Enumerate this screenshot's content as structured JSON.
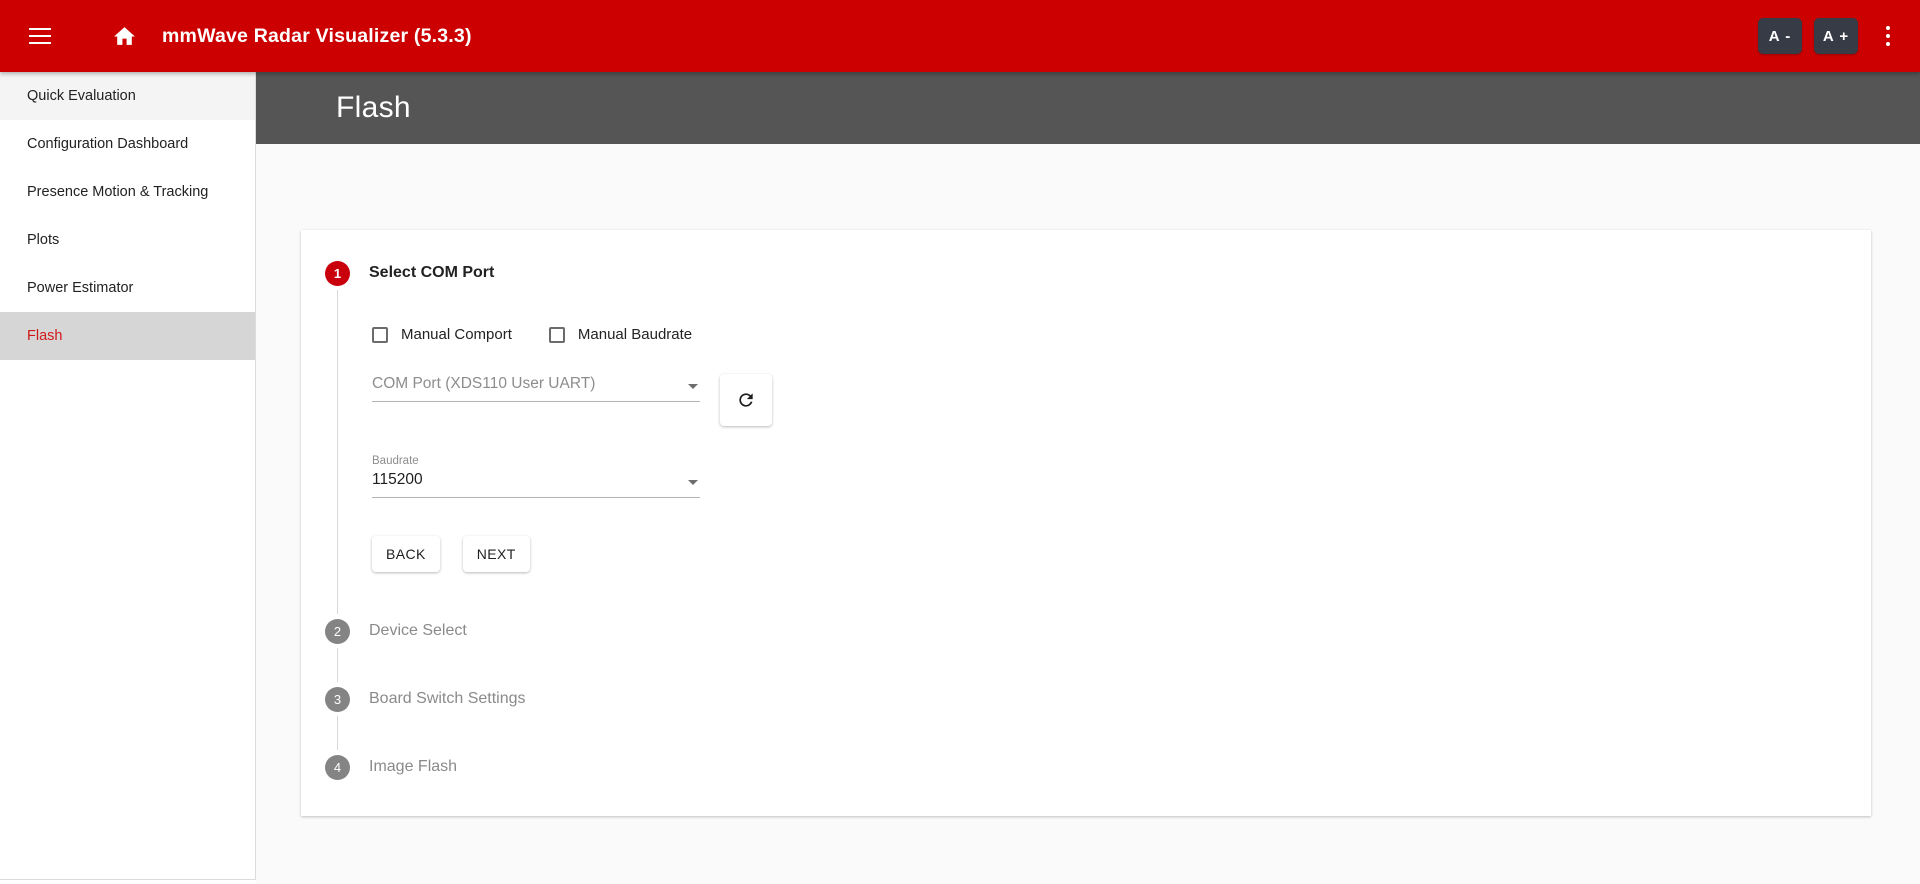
{
  "appbar": {
    "menu_icon": "hamburger-menu-icon",
    "home_icon": "home-icon",
    "title": "mmWave Radar Visualizer (5.3.3)",
    "font_decrease_label": "A -",
    "font_increase_label": "A +",
    "overflow_icon": "kebab-menu-icon",
    "background_color": "#cc0000"
  },
  "sidebar": {
    "items": [
      {
        "label": "Quick Evaluation",
        "state": "hovered"
      },
      {
        "label": "Configuration Dashboard",
        "state": "default"
      },
      {
        "label": "Presence Motion & Tracking",
        "state": "default"
      },
      {
        "label": "Plots",
        "state": "default"
      },
      {
        "label": "Power Estimator",
        "state": "default"
      },
      {
        "label": "Flash",
        "state": "active"
      }
    ],
    "active_color": "#d01818",
    "active_background": "#d6d6d6"
  },
  "page": {
    "title": "Flash",
    "header_background": "#555555",
    "body_background": "#fafafa"
  },
  "stepper": {
    "active_circle_color": "#c9000b",
    "idle_circle_color": "#848484",
    "steps": [
      {
        "number": "1",
        "label": "Select COM Port",
        "state": "active"
      },
      {
        "number": "2",
        "label": "Device Select",
        "state": "idle"
      },
      {
        "number": "3",
        "label": "Board Switch Settings",
        "state": "idle"
      },
      {
        "number": "4",
        "label": "Image Flash",
        "state": "idle"
      }
    ]
  },
  "step1": {
    "checkboxes": [
      {
        "label": "Manual Comport",
        "checked": false
      },
      {
        "label": "Manual Baudrate",
        "checked": false
      }
    ],
    "comport_select": {
      "placeholder": "COM Port (XDS110 User UART)",
      "value": "",
      "caret_icon": "chevron-down-icon"
    },
    "refresh_button": {
      "icon": "refresh-icon"
    },
    "baudrate_select": {
      "label": "Baudrate",
      "value": "115200",
      "caret_icon": "chevron-down-icon"
    },
    "back_label": "BACK",
    "next_label": "NEXT"
  }
}
